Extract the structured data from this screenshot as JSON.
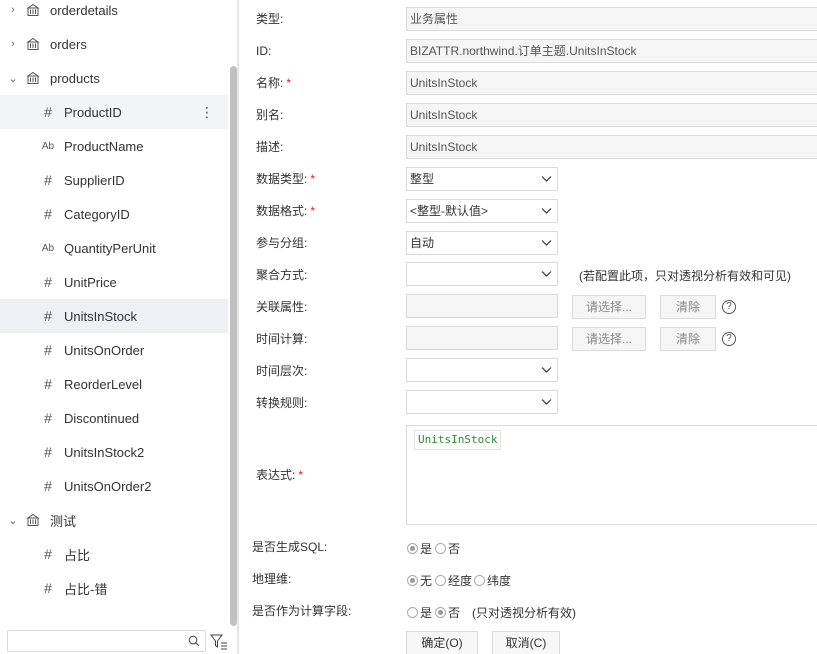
{
  "tree": {
    "tables": [
      {
        "label": "orderdetails",
        "chevron": "›"
      },
      {
        "label": "orders",
        "chevron": "›"
      },
      {
        "label": "products",
        "chevron": "⌄"
      }
    ],
    "fields": [
      {
        "label": "ProductID",
        "icon": "#"
      },
      {
        "label": "ProductName",
        "icon": "Ab"
      },
      {
        "label": "SupplierID",
        "icon": "#"
      },
      {
        "label": "CategoryID",
        "icon": "#"
      },
      {
        "label": "QuantityPerUnit",
        "icon": "Ab"
      },
      {
        "label": "UnitPrice",
        "icon": "#"
      },
      {
        "label": "UnitsInStock",
        "icon": "#"
      },
      {
        "label": "UnitsOnOrder",
        "icon": "#"
      },
      {
        "label": "ReorderLevel",
        "icon": "#"
      },
      {
        "label": "Discontinued",
        "icon": "#"
      },
      {
        "label": "UnitsInStock2",
        "icon": "#"
      },
      {
        "label": "UnitsOnOrder2",
        "icon": "#"
      }
    ],
    "test_table": {
      "label": "测试",
      "chevron": "⌄"
    },
    "test_fields": [
      {
        "label": "占比",
        "icon": "#"
      },
      {
        "label": "占比-错",
        "icon": "#"
      }
    ],
    "more_menu": "⋮",
    "search_placeholder": ""
  },
  "form": {
    "type_label": "类型:",
    "type_value": "业务属性",
    "id_label": "ID:",
    "id_value": "BIZATTR.northwind.订单主题.UnitsInStock",
    "name_label": "名称:",
    "name_value": "UnitsInStock",
    "alias_label": "别名:",
    "alias_value": "UnitsInStock",
    "desc_label": "描述:",
    "desc_value": "UnitsInStock",
    "datatype_label": "数据类型:",
    "datatype_value": "整型",
    "format_label": "数据格式:",
    "format_value": "<整型-默认值>",
    "group_label": "参与分组:",
    "group_value": "自动",
    "agg_label": "聚合方式:",
    "agg_value": "",
    "agg_hint": "(若配置此项，只对透视分析有效和可见)",
    "related_label": "关联属性:",
    "time_calc_label": "时间计算:",
    "select_btn": "请选择...",
    "clear_btn": "清除",
    "help_glyph": "?",
    "time_level_label": "时间层次:",
    "convert_label": "转换规则:",
    "expr_label": "表达式:",
    "expr_token": "UnitsInStock",
    "gen_sql_label": "是否生成SQL:",
    "gen_sql_options": [
      "是",
      "否"
    ],
    "geo_label": "地理维:",
    "geo_options": [
      "无",
      "经度",
      "纬度"
    ],
    "calc_field_label": "是否作为计算字段:",
    "calc_field_options": [
      "是",
      "否"
    ],
    "calc_field_hint": "(只对透视分析有效)",
    "required_mark": "*"
  },
  "footer": {
    "ok": "确定(O)",
    "cancel": "取消(C)"
  }
}
